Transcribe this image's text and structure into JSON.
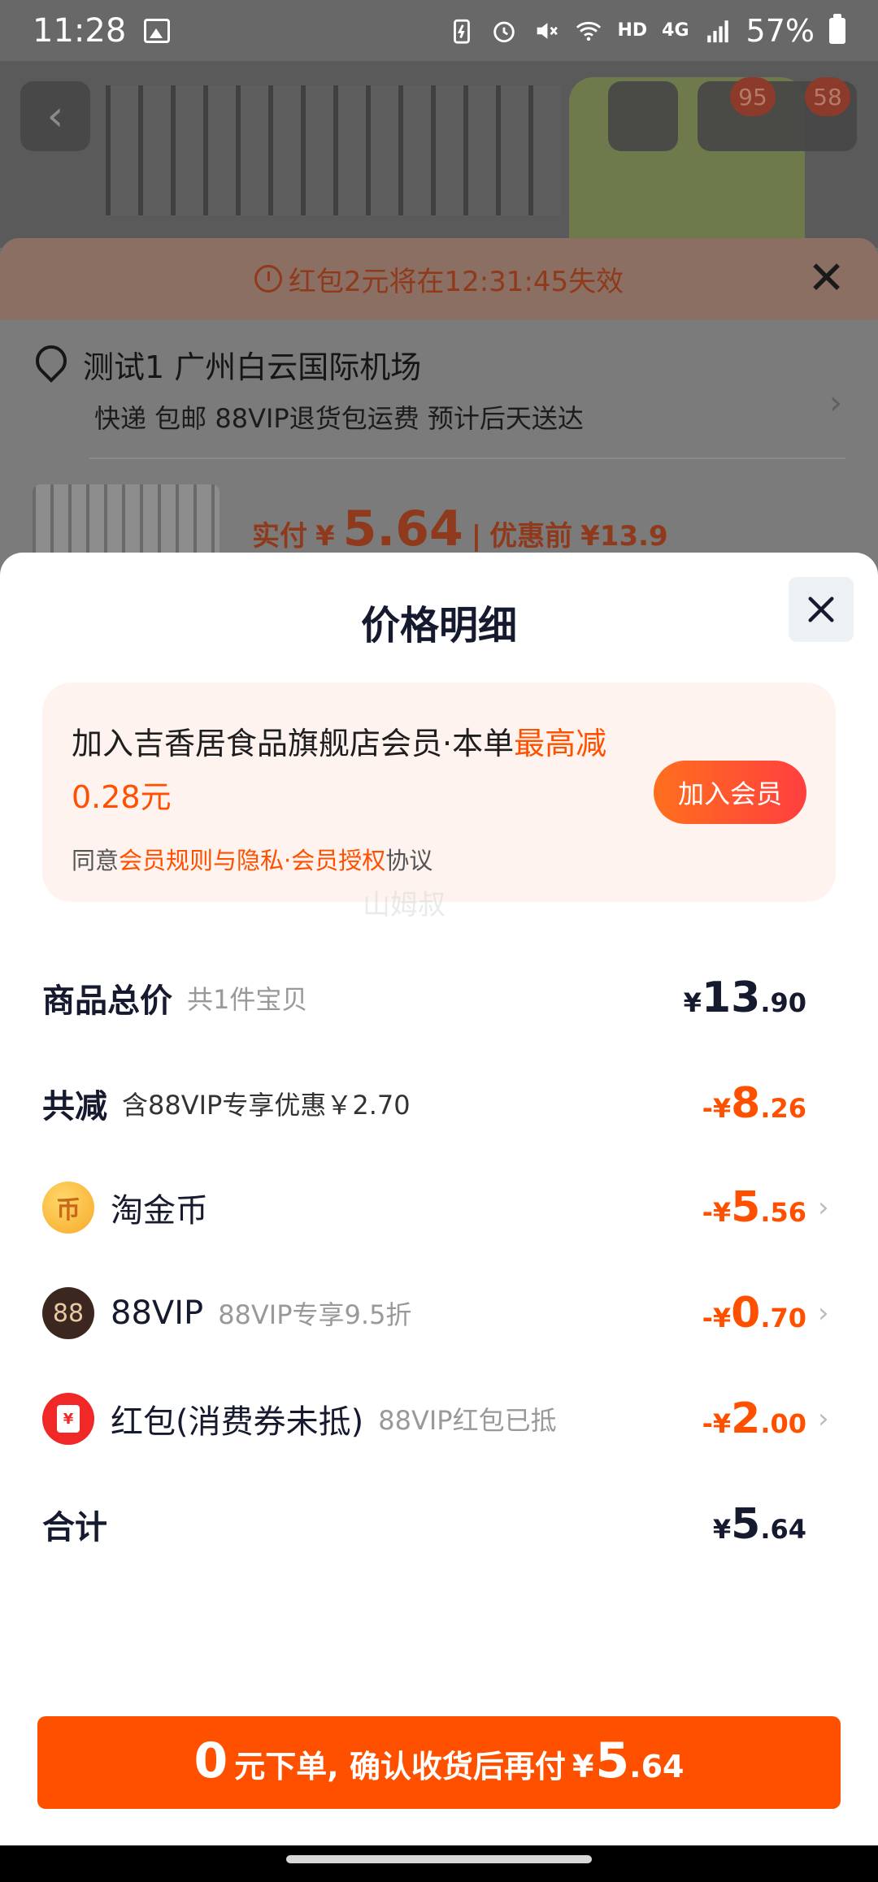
{
  "status_bar": {
    "time": "11:28",
    "hd": "HD",
    "network": "4G",
    "battery": "57%"
  },
  "background_page": {
    "cart_badge_1": "95",
    "cart_badge_2": "58",
    "back_icon": "chevron-left-icon"
  },
  "order_sheet": {
    "countdown": "红包2元将在12:31:45失效",
    "address": "测试1 广州白云国际机场",
    "shipping": "快递 包邮 88VIP退货包运费 预计后天送达",
    "paid_label": "实付",
    "paid_currency": "¥",
    "paid_amount": "5.64",
    "separator": "|",
    "before_label": "优惠前",
    "before_amount": "¥13.9"
  },
  "detail": {
    "title": "价格明细",
    "member": {
      "text_part1": "加入吉香居食品旗舰店会员·本单",
      "text_highlight": "最高减0.28元",
      "agree_prefix": "同意",
      "agree_link": "会员规则与隐私·会员授权",
      "agree_suffix": "协议",
      "join_label": "加入会员"
    },
    "watermark": "山姆叔",
    "rows": {
      "total": {
        "label": "商品总价",
        "sub": "共1件宝贝",
        "cur": "¥",
        "int": "13",
        "dec": ".90"
      },
      "discount": {
        "label": "共减",
        "sub": "含88VIP专享优惠￥2.70",
        "cur": "-¥",
        "int": "8",
        "dec": ".26"
      },
      "coin": {
        "label": "淘金币",
        "icon_glyph": "币",
        "cur": "-¥",
        "int": "5",
        "dec": ".56"
      },
      "vip": {
        "label": "88VIP",
        "icon_glyph": "88",
        "sub": "88VIP专享9.5折",
        "cur": "-¥",
        "int": "0",
        "dec": ".70"
      },
      "redpack": {
        "label": "红包(消费券未抵)",
        "icon_glyph": "¥",
        "sub": "88VIP红包已抵",
        "cur": "-¥",
        "int": "2",
        "dec": ".00"
      },
      "sum": {
        "label": "合计",
        "cur": "¥",
        "int": "5",
        "dec": ".64"
      }
    },
    "submit": {
      "big1": "0",
      "text": "元下单, 确认收货后再付",
      "cur": "¥",
      "big2": "5",
      "dec": ".64"
    }
  },
  "colors": {
    "accent": "#ff5000",
    "title": "#161a2e",
    "member_bg": "#fff3ef"
  }
}
